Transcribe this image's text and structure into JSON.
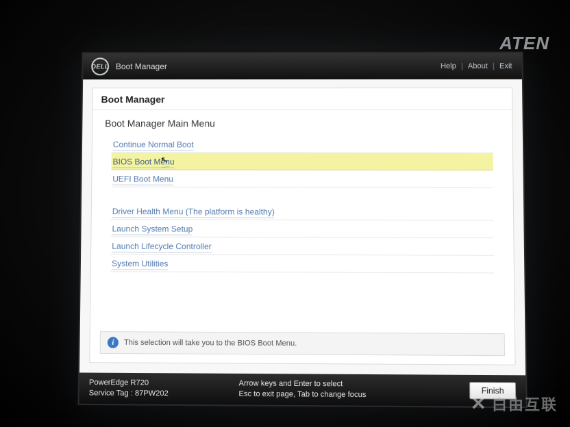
{
  "kvm_brand": "ATEN",
  "watermark": "白由互联",
  "header": {
    "brand": "DELL",
    "app_title": "Boot Manager",
    "links": {
      "help": "Help",
      "about": "About",
      "exit": "Exit"
    }
  },
  "panel": {
    "breadcrumb": "Boot Manager",
    "section_title": "Boot Manager Main Menu",
    "menu_group_a": [
      {
        "label": "Continue Normal Boot",
        "selected": false
      },
      {
        "label": "BIOS Boot Menu",
        "selected": true
      },
      {
        "label": "UEFI Boot Menu",
        "selected": false
      }
    ],
    "menu_group_b": [
      {
        "label": "Driver Health Menu (The platform is healthy)",
        "selected": false
      },
      {
        "label": "Launch System Setup",
        "selected": false
      },
      {
        "label": "Launch Lifecycle Controller",
        "selected": false
      },
      {
        "label": "System Utilities",
        "selected": false
      }
    ],
    "info_text": "This selection will take you to the BIOS Boot Menu."
  },
  "footer": {
    "model": "PowerEdge R720",
    "service_tag_label": "Service Tag",
    "service_tag_value": "87PW202",
    "hint_line1": "Arrow keys and Enter to select",
    "hint_line2": "Esc to exit page, Tab to change focus",
    "finish_label": "Finish"
  }
}
